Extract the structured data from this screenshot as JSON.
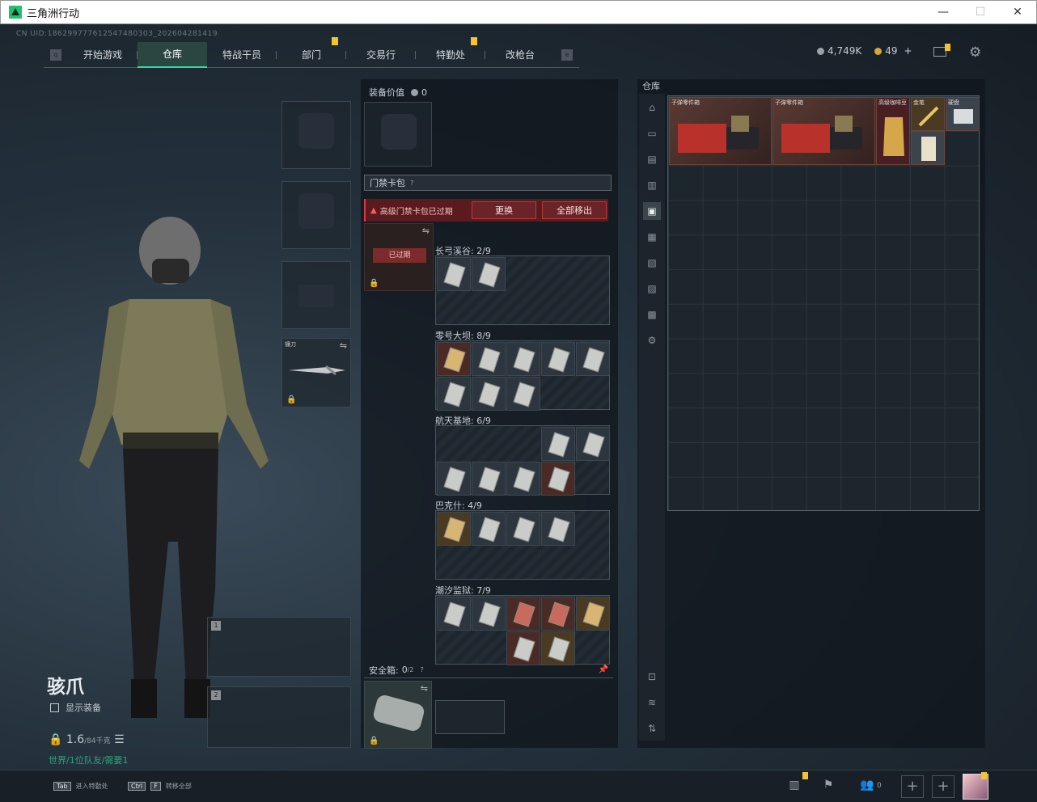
{
  "window": {
    "title": "三角洲行动",
    "min": "—",
    "max": "☐",
    "close": "✕"
  },
  "uid": "CN UID:18629977761254748030З_202604281419",
  "nav": {
    "left_icon": "q",
    "right_icon": "e",
    "tabs": [
      {
        "label": "开始游戏"
      },
      {
        "label": "仓库"
      },
      {
        "label": "特战干员"
      },
      {
        "label": "部门"
      },
      {
        "label": "交易行"
      },
      {
        "label": "特勤处"
      },
      {
        "label": "改枪台"
      }
    ],
    "active_tab": "仓库",
    "badged_tabs": [
      "部门",
      "特勤处"
    ]
  },
  "currency": {
    "havoc": "4,749K",
    "coupon": "49",
    "plus": "+"
  },
  "operator": {
    "name": "骇爪",
    "show_equipment": "显示装备",
    "weight": "1.6",
    "weight_max": "/84千克",
    "status": "世界/1位队友/需要1"
  },
  "knife_slot": {
    "label": "镰刀"
  },
  "weapon_slots": [
    {
      "num": "1"
    },
    {
      "num": "2"
    }
  ],
  "equipment": {
    "value_label": "装备价值",
    "value": "0",
    "card_pack_title": "门禁卡包",
    "help": "?",
    "warning": "高级门禁卡包已过期",
    "replace_btn": "更换",
    "remove_all_btn": "全部移出",
    "expired_tag": "已过期",
    "groups": [
      {
        "name": "长弓溪谷: 2/9"
      },
      {
        "name": "零号大坝: 8/9"
      },
      {
        "name": "航天基地: 6/9"
      },
      {
        "name": "巴克什: 4/9"
      },
      {
        "name": "潮汐监狱: 7/9"
      }
    ],
    "safebox_label": "安全箱:",
    "safebox_count": "0",
    "safebox_max": "/2"
  },
  "stash": {
    "title": "仓库",
    "items": [
      {
        "label": "子弹零件箱"
      },
      {
        "label": "子弹零件箱"
      },
      {
        "label": "高级咖啡豆"
      },
      {
        "label": "金笔"
      },
      {
        "label": "硬盘"
      }
    ]
  },
  "bottom": {
    "tab_hint": "进入特勤处",
    "tab_key": "Tab",
    "ctrl_key": "Ctrl",
    "f_key": "F",
    "ctrl_hint": "转移全部",
    "friends": "0"
  }
}
